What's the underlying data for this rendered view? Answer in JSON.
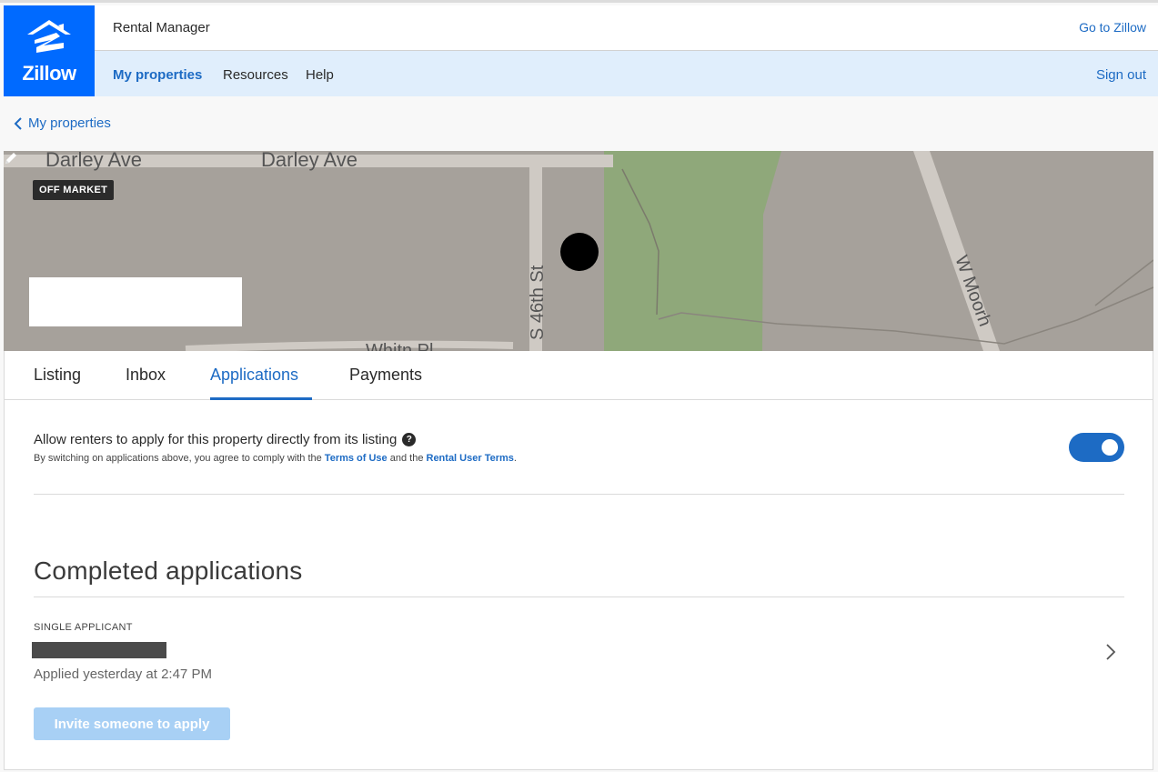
{
  "header": {
    "logo_text": "Zillow",
    "app_title": "Rental Manager",
    "go_link": "Go to Zillow",
    "nav": [
      "My properties",
      "Resources",
      "Help"
    ],
    "sign_out": "Sign out"
  },
  "breadcrumb": {
    "back_label": "My properties"
  },
  "map": {
    "badge": "OFF MARKET",
    "street_labels": [
      "Darley Ave",
      "Darley Ave",
      "S 46th St",
      "W Moorh",
      "Whitn    Pl"
    ]
  },
  "tabs": [
    {
      "label": "Listing",
      "active": false
    },
    {
      "label": "Inbox",
      "active": false
    },
    {
      "label": "Applications",
      "active": true
    },
    {
      "label": "Payments",
      "active": false
    }
  ],
  "applications_setting": {
    "title": "Allow renters to apply for this property directly from its listing",
    "help_icon": "?",
    "terms_prefix": "By switching on applications above, you agree to comply with the",
    "terms_link": "Terms of Use",
    "terms_mid": "and the",
    "rental_link": "Rental User Terms",
    "terms_suffix": ".",
    "toggle_on": true
  },
  "completed": {
    "heading": "Completed applications",
    "applicant_type": "SINGLE APPLICANT",
    "applied_text": "Applied yesterday at 2:47 PM",
    "invite_button": "Invite someone to apply"
  },
  "colors": {
    "brand": "#006aff",
    "link": "#1d6bc4",
    "nav_bg": "#e0eefc",
    "map_bg": "#a6a19b",
    "park": "#8fa87a",
    "invite_disabled": "#a8d0f5"
  }
}
